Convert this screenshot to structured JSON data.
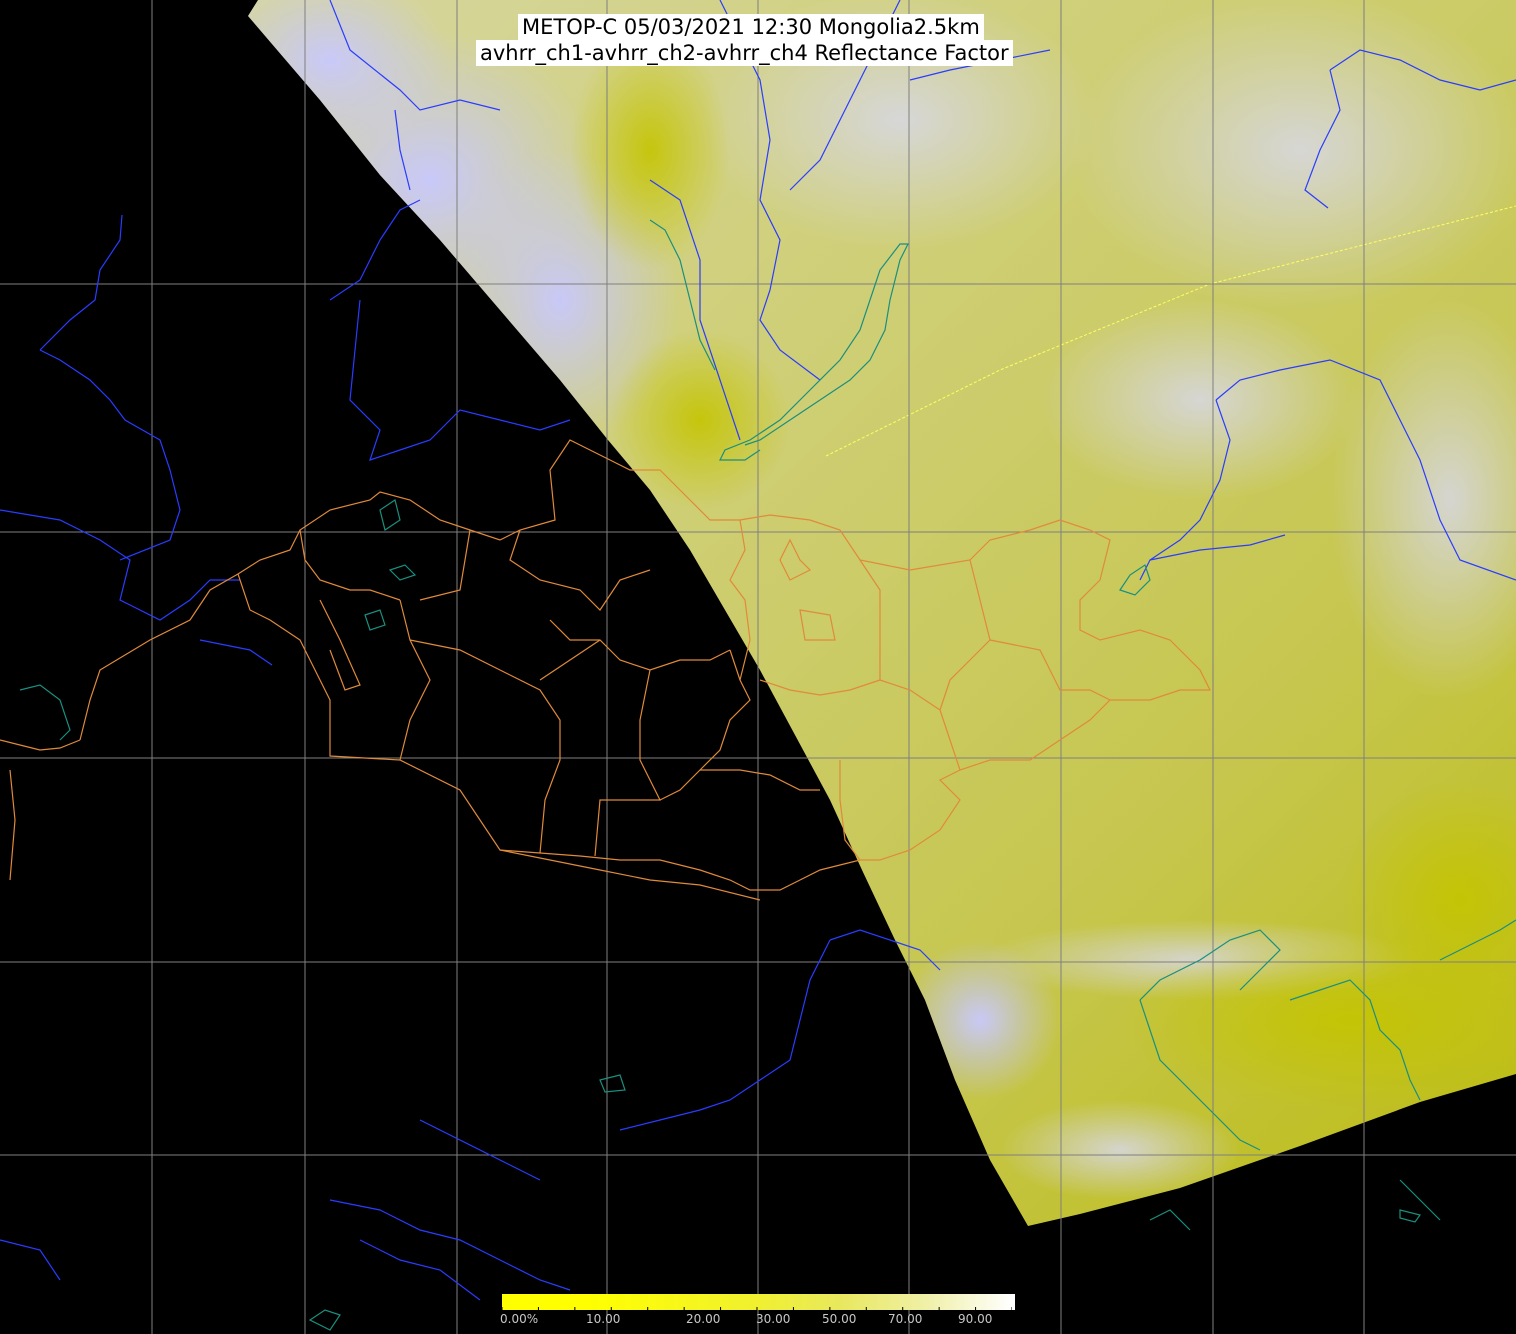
{
  "title": {
    "line1": "METOP-C 05/03/2021 12:30 Mongolia2.5km",
    "line2": "avhrr_ch1-avhrr_ch2-avhrr_ch4 Reflectance Factor"
  },
  "legend": {
    "labels": [
      "0.00%",
      "10.00",
      "20.00",
      "30.00",
      "50.00",
      "70.00",
      "90.00"
    ],
    "colors": [
      "#ffff00",
      "#ffff00",
      "#f8f818",
      "#f0f030",
      "#e8e860",
      "#f0f0a8",
      "#ffffff"
    ]
  },
  "colors": {
    "background": "#000000",
    "grid": "#7f7f7f",
    "rivers": "#2a3cff",
    "coast": "#1a8f7f",
    "admin_borders": "#e08a3a",
    "image_base": "#c8c85a",
    "cloud": "#c8c8f0"
  }
}
